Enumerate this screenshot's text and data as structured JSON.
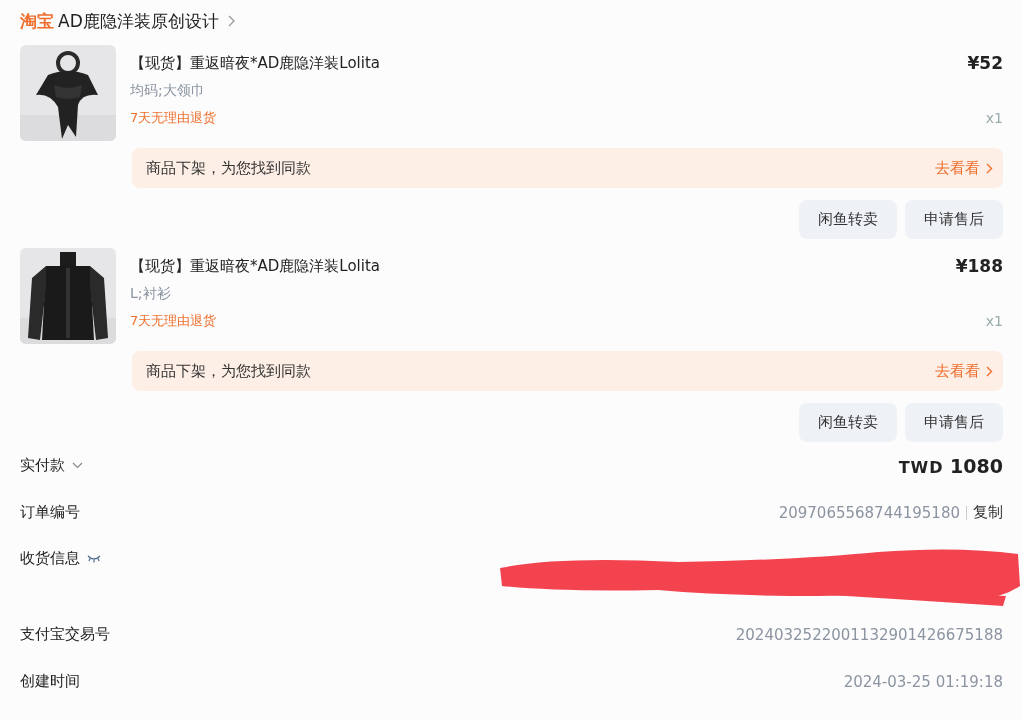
{
  "shop": {
    "platform": "淘宝",
    "name": "AD鹿隐洋装原创设计"
  },
  "items": [
    {
      "kind": "picture",
      "title": "【现货】重返暗夜*AD鹿隐洋装Lolita",
      "variant": "均码;大领巾",
      "price": "¥52",
      "return_policy": "7天无理由退货",
      "quantity": "x1",
      "notice": "商品下架，为您找到同款",
      "notice_link": "去看看",
      "buttons": [
        "闲鱼转卖",
        "申请售后"
      ]
    },
    {
      "kind": "picture",
      "title": "【现货】重返暗夜*AD鹿隐洋装Lolita",
      "variant": "L;衬衫",
      "price": "¥188",
      "return_policy": "7天无理由退货",
      "quantity": "x1",
      "notice": "商品下架，为您找到同款",
      "notice_link": "去看看",
      "buttons": [
        "闲鱼转卖",
        "申请售后"
      ]
    }
  ],
  "details": [
    {
      "kind": "total",
      "label": "实付款",
      "currency": "TWD",
      "value": "1080"
    },
    {
      "kind": "copy",
      "label": "订单编号",
      "value": "2097065568744195180",
      "action": "复制"
    },
    {
      "kind": "hidden",
      "label": "收货信息"
    },
    {
      "kind": "plain",
      "label": "支付宝交易号",
      "value": "2024032522001132901426675188"
    },
    {
      "kind": "plain",
      "label": "创建时间",
      "value": "2024-03-25 01:19:18"
    }
  ]
}
